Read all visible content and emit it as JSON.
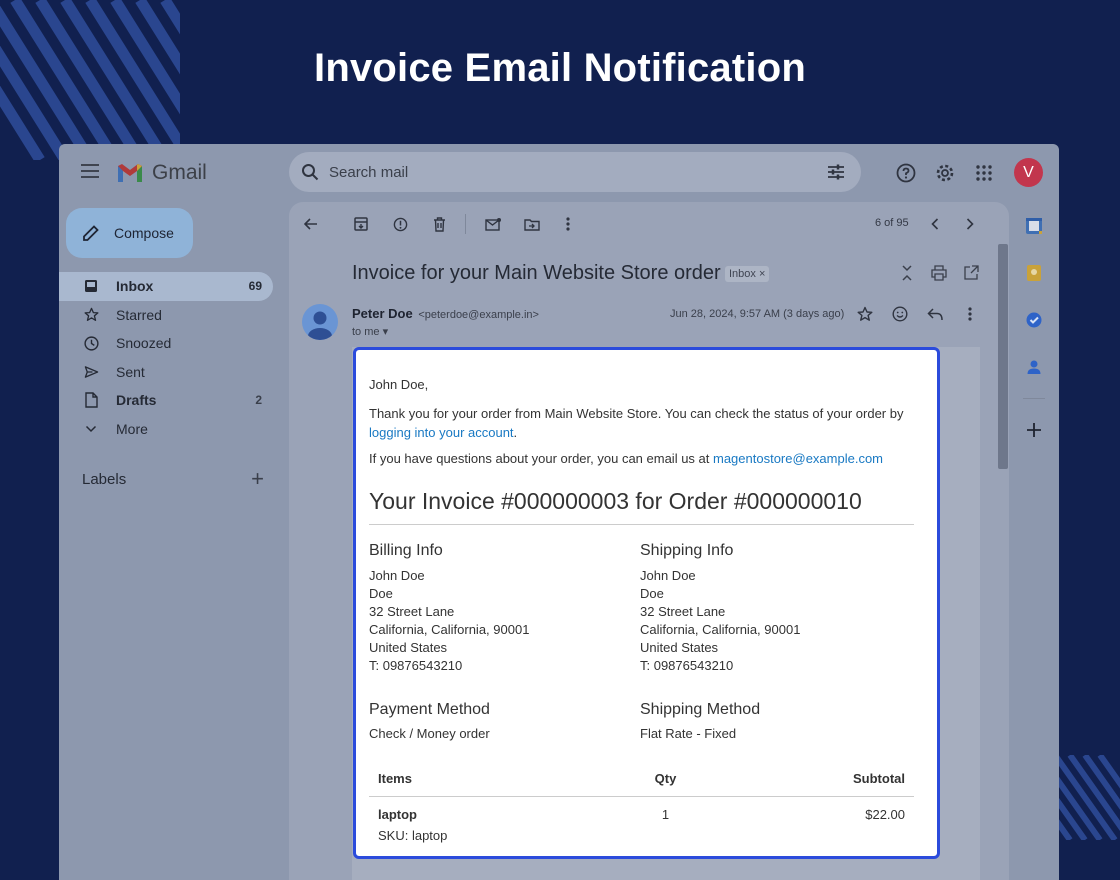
{
  "banner": {
    "title": "Invoice Email Notification"
  },
  "gmail": {
    "logo_text": "Gmail",
    "search_placeholder": "Search mail",
    "avatar_letter": "V",
    "compose_label": "Compose",
    "nav": [
      {
        "label": "Inbox",
        "count": "69",
        "icon": "inbox-icon"
      },
      {
        "label": "Starred",
        "count": "",
        "icon": "star-icon"
      },
      {
        "label": "Snoozed",
        "count": "",
        "icon": "clock-icon"
      },
      {
        "label": "Sent",
        "count": "",
        "icon": "send-icon"
      },
      {
        "label": "Drafts",
        "count": "2",
        "icon": "draft-icon"
      },
      {
        "label": "More",
        "count": "",
        "icon": "chevron-down-icon"
      }
    ],
    "labels_title": "Labels",
    "pager": "6 of 95",
    "subject": "Invoice for your Main Website Store order",
    "inbox_chip": "Inbox ×",
    "sender_name": "Peter Doe",
    "sender_email": "<peterdoe@example.in>",
    "to_line": "to me ▾",
    "date": "Jun 28, 2024, 9:57 AM (3 days ago)"
  },
  "email": {
    "greeting": "John Doe,",
    "thanks_text": "Thank you for your order from Main Website Store. You can check the status of your order by ",
    "account_link": "logging into your account",
    "thanks_end": ".",
    "questions_text": "If you have questions about your order, you can email us at ",
    "store_email": "magentostore@example.com",
    "invoice_title": "Your Invoice #000000003 for Order #000000010",
    "billing": {
      "heading": "Billing Info",
      "lines": [
        "John Doe",
        "Doe",
        "32 Street Lane",
        "California, California, 90001",
        "United States",
        "T: 09876543210"
      ]
    },
    "shipping": {
      "heading": "Shipping Info",
      "lines": [
        "John Doe",
        "Doe",
        "32 Street Lane",
        "California, California, 90001",
        "United States",
        "T: 09876543210"
      ]
    },
    "payment": {
      "heading": "Payment Method",
      "value": "Check / Money order"
    },
    "shipping_method": {
      "heading": "Shipping Method",
      "value": "Flat Rate - Fixed"
    },
    "items_table": {
      "headers": [
        "Items",
        "Qty",
        "Subtotal"
      ],
      "rows": [
        {
          "item": "laptop",
          "qty": "1",
          "subtotal": "$22.00",
          "sku": "SKU: laptop"
        }
      ]
    }
  },
  "colors": {
    "background": "#11204f",
    "card_border": "#2b4bdc",
    "link": "#1979c3",
    "avatar": "#c2364d"
  }
}
